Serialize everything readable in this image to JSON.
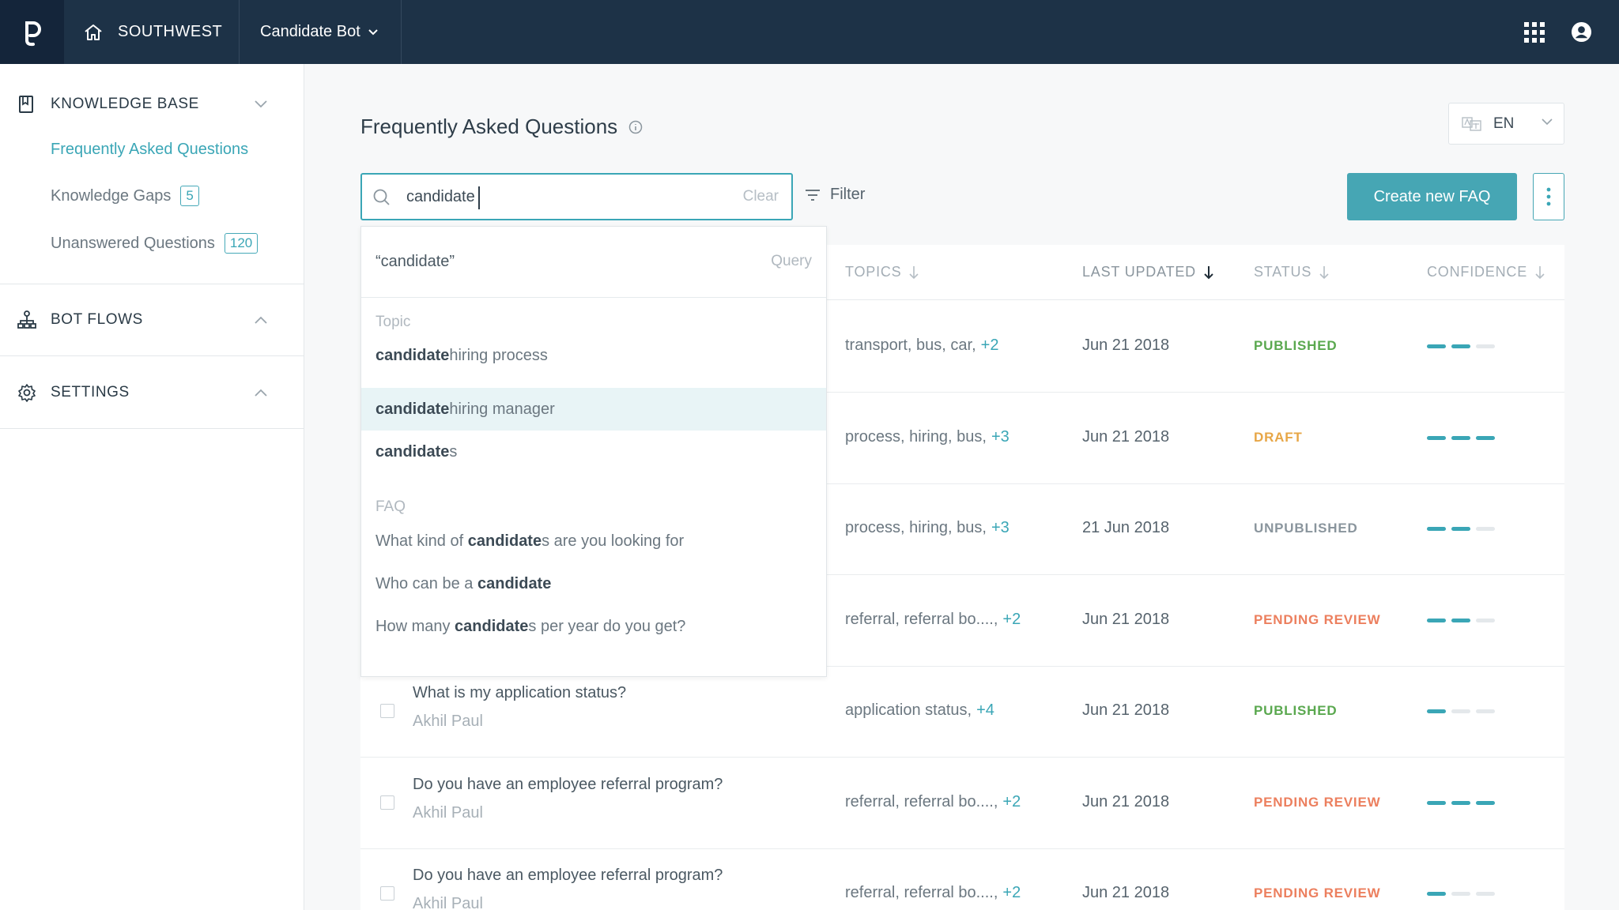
{
  "topbar": {
    "org_name": "SOUTHWEST",
    "bot_name": "Candidate Bot"
  },
  "sidebar": {
    "knowledge_base": {
      "label": "KNOWLEDGE BASE",
      "items": [
        {
          "label": "Frequently Asked Questions"
        },
        {
          "label": "Knowledge Gaps",
          "count": "5"
        },
        {
          "label": "Unanswered Questions",
          "count": "120"
        }
      ]
    },
    "bot_flows": {
      "label": "BOT FLOWS"
    },
    "settings": {
      "label": "SETTINGS"
    }
  },
  "main": {
    "title": "Frequently Asked Questions",
    "language": "EN",
    "search": {
      "value": "candidate",
      "clear_label": "Clear"
    },
    "filter_label": "Filter",
    "create_label": "Create new FAQ"
  },
  "dropdown": {
    "query_text": "“candidate”",
    "query_label": "Query",
    "topic_heading": "Topic",
    "topics": [
      {
        "match": "candidate",
        "rest": " hiring process"
      },
      {
        "match": "candidate",
        "rest": " hiring manager"
      },
      {
        "match": "candidate",
        "rest": "s"
      }
    ],
    "faq_heading": "FAQ",
    "faqs": [
      {
        "pre": "What kind of ",
        "match": "candidate",
        "rest": "s are you looking for"
      },
      {
        "pre": "Who can be a ",
        "match": "candidate",
        "rest": ""
      },
      {
        "pre": "How many ",
        "match": "candidate",
        "rest": "s per year do you get?"
      }
    ]
  },
  "table": {
    "columns": {
      "topics": "TOPICS",
      "last_updated": "LAST UPDATED",
      "status": "STATUS",
      "confidence": "CONFIDENCE"
    },
    "rows": [
      {
        "question": "",
        "author": "",
        "topics": "transport, bus, car,",
        "more": "+2",
        "updated": "Jun 21 2018",
        "status": "PUBLISHED",
        "status_color": "#5aa84f",
        "confidence": 2
      },
      {
        "question": "",
        "author": "",
        "topics": "process, hiring, bus,",
        "more": "+3",
        "updated": "Jun 21 2018",
        "status": "DRAFT",
        "status_color": "#e7a646",
        "confidence": 3
      },
      {
        "question": "",
        "author": "",
        "topics": "process, hiring, bus,",
        "more": "+3",
        "updated": "21 Jun 2018",
        "status": "UNPUBLISHED",
        "status_color": "#8a959d",
        "confidence": 2
      },
      {
        "question": "",
        "author": "",
        "topics": "referral, referral bo....,",
        "more": "+2",
        "updated": "Jun 21 2018",
        "status": "PENDING REVIEW",
        "status_color": "#ec7f5e",
        "confidence": 2
      },
      {
        "question": "What is my application status?",
        "author": "Akhil Paul",
        "topics": "application status,",
        "more": "+4",
        "updated": "Jun 21 2018",
        "status": "PUBLISHED",
        "status_color": "#5aa84f",
        "confidence": 1
      },
      {
        "question": "Do you have an employee referral program?",
        "author": "Akhil Paul",
        "topics": "referral, referral bo....,",
        "more": "+2",
        "updated": "Jun 21 2018",
        "status": "PENDING REVIEW",
        "status_color": "#ec7f5e",
        "confidence": 3
      },
      {
        "question": "Do you have an employee referral program?",
        "author": "Akhil Paul",
        "topics": "referral, referral bo....,",
        "more": "+2",
        "updated": "Jun 21 2018",
        "status": "PENDING REVIEW",
        "status_color": "#ec7f5e",
        "confidence": 1
      }
    ]
  },
  "colors": {
    "accent": "#3aa6b6",
    "topbar": "#1d3247"
  }
}
